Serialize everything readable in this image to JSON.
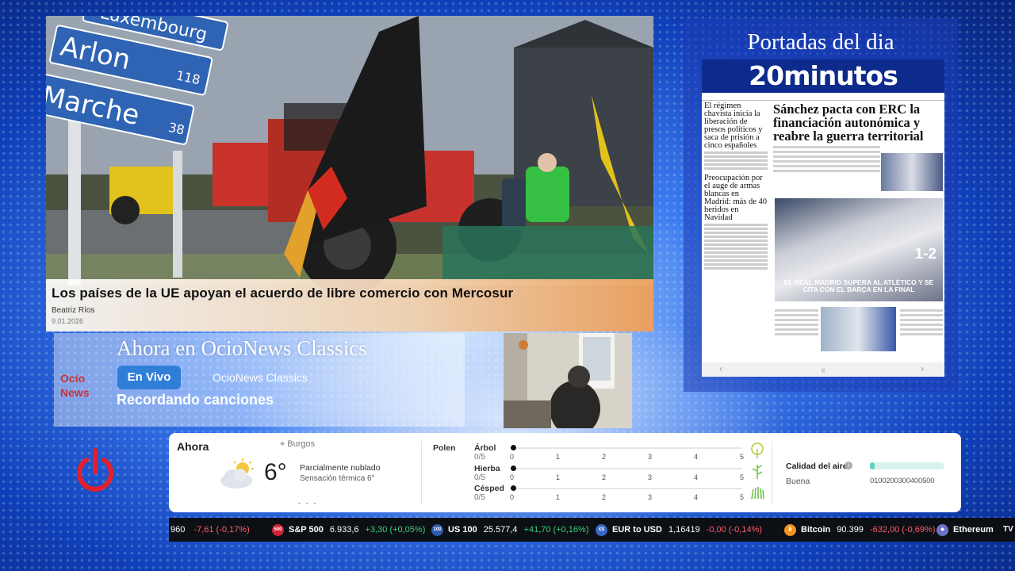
{
  "news": {
    "title": "Los países de la UE apoyan el acuerdo de libre comercio con Mercosur",
    "author": "Beatriz Ríos",
    "date": "9.01.2026",
    "image_signs": [
      "Luxembourg",
      "Arlon 118",
      "Marche 38"
    ]
  },
  "frontpage": {
    "panel_title": "Portadas del dia",
    "paper_name": "20minutos",
    "left_headline_1": "El régimen chavista inicia la liberación de presos políticos y saca de prisión a cinco españoles",
    "left_headline_2": "Preocupación por el auge de armas blancas en Madrid: más de 40 heridos en Navidad",
    "main_headline": "Sánchez pacta con ERC la financiación autonómica y reabre la guerra territorial",
    "photo_score": "1-2",
    "photo_caption": "EL REAL MADRID SUPERA AL ATLÉTICO Y SE CITA CON EL BARÇA EN LA FINAL",
    "nav_prev": "‹",
    "nav_pause": "॥",
    "nav_next": "›"
  },
  "ocionews": {
    "heading": "Ahora en OcioNews Classics",
    "live_label": "En Vivo",
    "channel": "OcioNews Classics",
    "song": "Recordando canciones",
    "logo_line1": "Ocio",
    "logo_line2": "News"
  },
  "weather": {
    "now_label": "Ahora",
    "location": "Burgos",
    "temperature": "6°",
    "condition": "Parcialmente nublado",
    "feels_like": "Sensación térmica 6°",
    "pager": "• • •",
    "pollen_title": "Polen",
    "pollen": [
      {
        "name": "Árbol",
        "value": "0/5",
        "level": 0
      },
      {
        "name": "Hierba",
        "value": "0/5",
        "level": 0
      },
      {
        "name": "Césped",
        "value": "0/5",
        "level": 0
      }
    ],
    "pollen_scale": [
      "0",
      "1",
      "2",
      "3",
      "4",
      "5"
    ],
    "air_quality_title": "Calidad del aire",
    "air_quality_info": "i",
    "air_quality_status": "Buena",
    "air_quality_scale": "0100200300400500",
    "air_quality_level": 0.06
  },
  "ticker": [
    {
      "name": "",
      "price": "960",
      "change": "-7,61 (-0,17%)",
      "direction": "down",
      "badge": "",
      "badge_color": ""
    },
    {
      "name": "S&P 500",
      "price": "6.933,6",
      "change": "+3,30 (+0,05%)",
      "direction": "up",
      "badge": "500",
      "badge_color": "#d0213a"
    },
    {
      "name": "US 100",
      "price": "25.577,4",
      "change": "+41,70 (+0,16%)",
      "direction": "up",
      "badge": "100",
      "badge_color": "#2b5aa8"
    },
    {
      "name": "EUR to USD",
      "price": "1,16419",
      "change": "-0,00 (-0,14%)",
      "direction": "down",
      "badge": "€$",
      "badge_color": "#3a66c4"
    },
    {
      "name": "Bitcoin",
      "price": "90.399",
      "change": "-632,00 (-0,69%)",
      "direction": "down",
      "badge": "₿",
      "badge_color": "#f2931b"
    },
    {
      "name": "Ethereum",
      "price": "",
      "change": "",
      "direction": "",
      "badge": "◆",
      "badge_color": "#6b73c9"
    }
  ],
  "ticker_logo": "TV"
}
